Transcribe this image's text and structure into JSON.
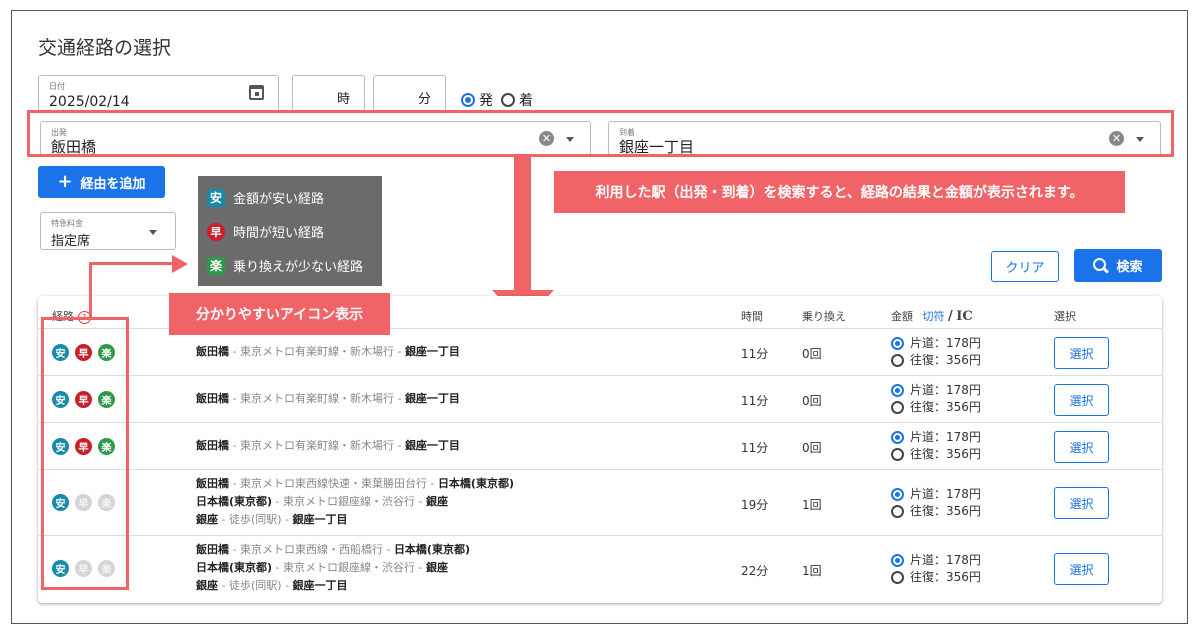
{
  "page_title": "交通経路の選択",
  "date_field": {
    "label": "日付",
    "value": "2025/02/14"
  },
  "hour_field": {
    "unit": "時"
  },
  "minute_field": {
    "unit": "分"
  },
  "depart_arrive": {
    "depart_label": "発",
    "arrive_label": "着",
    "selected": "発"
  },
  "from_field": {
    "label": "出発",
    "value": "飯田橋"
  },
  "to_field": {
    "label": "到着",
    "value": "銀座一丁目"
  },
  "add_via_button": "経由を追加",
  "express_field": {
    "label": "特急料金",
    "value": "指定席"
  },
  "legend": [
    {
      "icon": "安",
      "text": "金額が安い経路",
      "color": "#1b8aa8"
    },
    {
      "icon": "早",
      "text": "時間が短い経路",
      "color": "#c8202c"
    },
    {
      "icon": "楽",
      "text": "乗り換えが少ない経路",
      "color": "#2e9a47"
    }
  ],
  "callout_search": "利用した駅（出発・到着）を検索すると、経路の結果と金額が表示されます。",
  "callout_icons": "分かりやすいアイコン表示",
  "clear_button": "クリア",
  "search_button": "検索",
  "table": {
    "headers": {
      "route": "経路",
      "time": "時間",
      "transfers": "乗り換え",
      "fare": "金額",
      "fare_ticket": "切符",
      "fare_sep": "/",
      "fare_ic": "IC",
      "select": "選択"
    },
    "rows": [
      {
        "icons": [
          "安",
          "早",
          "楽"
        ],
        "icons_active": [
          true,
          true,
          true
        ],
        "route_lines": [
          {
            "from": "飯田橋",
            "line": "東京メトロ有楽町線・新木場行",
            "to": "銀座一丁目"
          }
        ],
        "time": "11分",
        "transfers": "0回",
        "one_way": "片道：178円",
        "round_trip": "往復：356円",
        "select": "選択"
      },
      {
        "icons": [
          "安",
          "早",
          "楽"
        ],
        "icons_active": [
          true,
          true,
          true
        ],
        "route_lines": [
          {
            "from": "飯田橋",
            "line": "東京メトロ有楽町線・新木場行",
            "to": "銀座一丁目"
          }
        ],
        "time": "11分",
        "transfers": "0回",
        "one_way": "片道：178円",
        "round_trip": "往復：356円",
        "select": "選択"
      },
      {
        "icons": [
          "安",
          "早",
          "楽"
        ],
        "icons_active": [
          true,
          true,
          true
        ],
        "route_lines": [
          {
            "from": "飯田橋",
            "line": "東京メトロ有楽町線・新木場行",
            "to": "銀座一丁目"
          }
        ],
        "time": "11分",
        "transfers": "0回",
        "one_way": "片道：178円",
        "round_trip": "往復：356円",
        "select": "選択"
      },
      {
        "icons": [
          "安",
          "早",
          "楽"
        ],
        "icons_active": [
          true,
          false,
          false
        ],
        "route_lines": [
          {
            "from": "飯田橋",
            "line": "東京メトロ東西線快速・東葉勝田台行",
            "to": "日本橋(東京都)"
          },
          {
            "from": "日本橋(東京都)",
            "line": "東京メトロ銀座線・渋谷行",
            "to": "銀座"
          },
          {
            "from": "銀座",
            "line": "徒歩(同駅)",
            "to": "銀座一丁目"
          }
        ],
        "time": "19分",
        "transfers": "1回",
        "one_way": "片道：178円",
        "round_trip": "往復：356円",
        "select": "選択"
      },
      {
        "icons": [
          "安",
          "早",
          "楽"
        ],
        "icons_active": [
          true,
          false,
          false
        ],
        "route_lines": [
          {
            "from": "飯田橋",
            "line": "東京メトロ東西線・西船橋行",
            "to": "日本橋(東京都)"
          },
          {
            "from": "日本橋(東京都)",
            "line": "東京メトロ銀座線・渋谷行",
            "to": "銀座"
          },
          {
            "from": "銀座",
            "line": "徒歩(同駅)",
            "to": "銀座一丁目"
          }
        ],
        "time": "22分",
        "transfers": "1回",
        "one_way": "片道：178円",
        "round_trip": "往復：356円",
        "select": "選択"
      }
    ]
  },
  "colors": {
    "accent": "#1a73e8",
    "highlight": "#f06468",
    "legend_bg": "#6b6b6b"
  }
}
